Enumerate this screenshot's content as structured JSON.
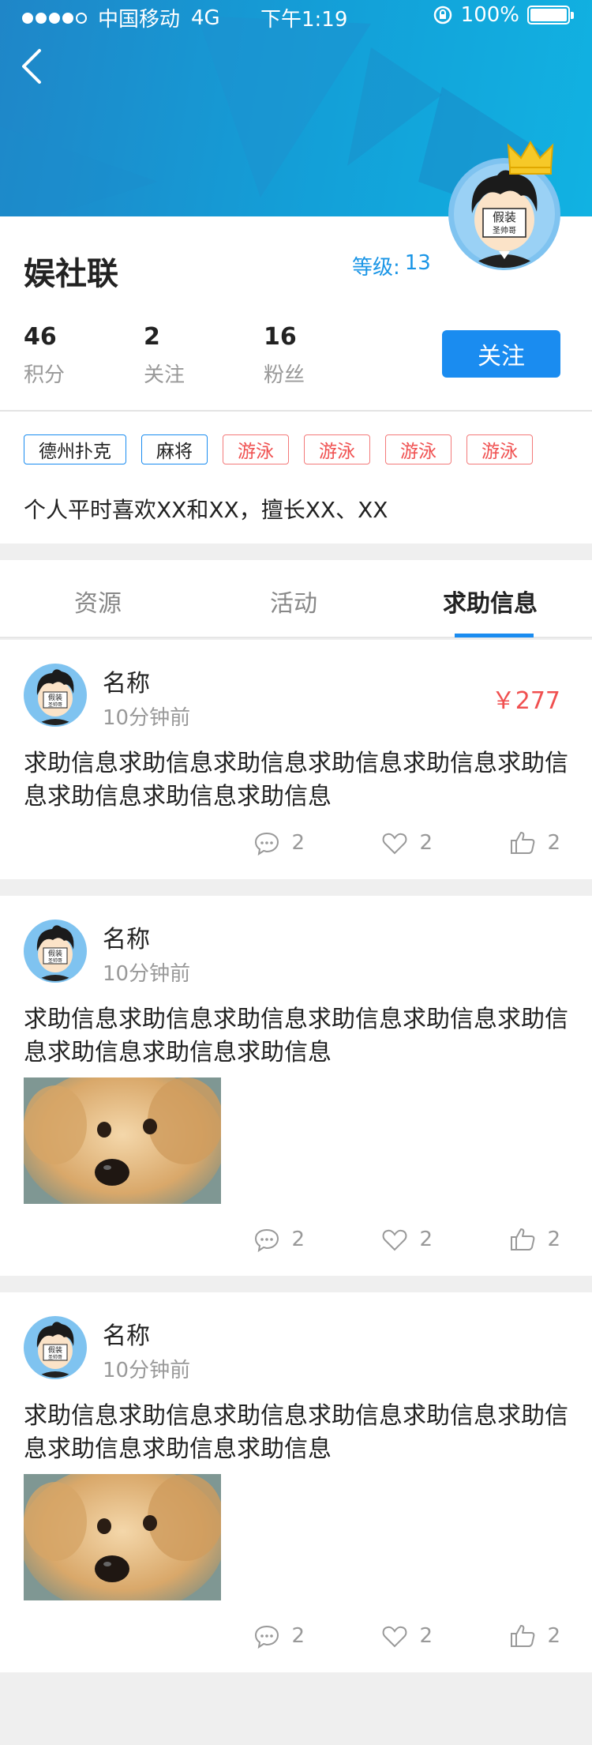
{
  "status_bar": {
    "carrier": "中国移动",
    "network": "4G",
    "time": "下午1:19",
    "battery": "100%"
  },
  "profile": {
    "name": "娱社联",
    "level_label": "等级:",
    "level_value": "13",
    "stats": [
      {
        "value": "46",
        "label": "积分"
      },
      {
        "value": "2",
        "label": "关注"
      },
      {
        "value": "16",
        "label": "粉丝"
      }
    ],
    "follow_button": "关注",
    "tags": [
      {
        "label": "德州扑克",
        "color": "blue"
      },
      {
        "label": "麻将",
        "color": "blue"
      },
      {
        "label": "游泳",
        "color": "red"
      },
      {
        "label": "游泳",
        "color": "red"
      },
      {
        "label": "游泳",
        "color": "red"
      },
      {
        "label": "游泳",
        "color": "red"
      }
    ],
    "bio": "个人平时喜欢XX和XX，擅长XX、XX",
    "avatar_text": [
      "假装",
      "圣帅哥"
    ]
  },
  "tabs": [
    {
      "label": "资源",
      "active": false
    },
    {
      "label": "活动",
      "active": false
    },
    {
      "label": "求助信息",
      "active": true
    }
  ],
  "posts": [
    {
      "name": "名称",
      "time": "10分钟前",
      "price": "￥277",
      "text": "求助信息求助信息求助信息求助信息求助信息求助信息求助信息求助信息求助信息",
      "has_image": false,
      "comments": "2",
      "likes": "2",
      "thumbs": "2"
    },
    {
      "name": "名称",
      "time": "10分钟前",
      "price": "",
      "text": "求助信息求助信息求助信息求助信息求助信息求助信息求助信息求助信息求助信息",
      "has_image": true,
      "comments": "2",
      "likes": "2",
      "thumbs": "2"
    },
    {
      "name": "名称",
      "time": "10分钟前",
      "price": "",
      "text": "求助信息求助信息求助信息求助信息求助信息求助信息求助信息求助信息求助信息",
      "has_image": true,
      "comments": "2",
      "likes": "2",
      "thumbs": "2"
    }
  ],
  "colors": {
    "accent": "#1a8cf0",
    "price_red": "#f05050",
    "banner_start": "#1f86c8",
    "banner_end": "#11b2e2"
  }
}
